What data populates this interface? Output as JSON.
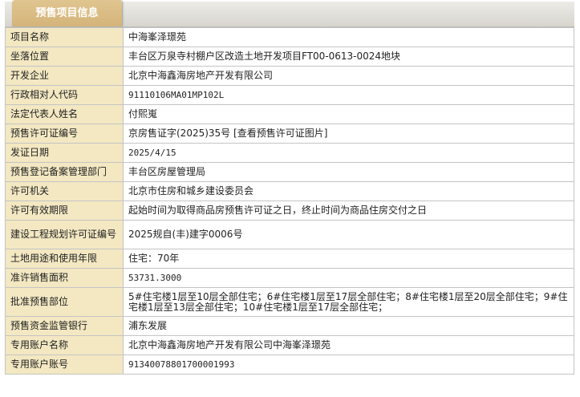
{
  "header": {
    "tab_title": "预售项目信息"
  },
  "rows": [
    {
      "label": "项目名称",
      "value": "中海峯泽璟苑"
    },
    {
      "label": "坐落位置",
      "value": "丰台区万泉寺村棚户区改造土地开发项目FT00-0613-0024地块"
    },
    {
      "label": "开发企业",
      "value": "北京中海鑫海房地产开发有限公司"
    },
    {
      "label": "行政相对人代码",
      "value": "91110106MA01MP102L"
    },
    {
      "label": "法定代表人姓名",
      "value": "付熙嵬"
    },
    {
      "label": "预售许可证编号",
      "value": "京房售证字(2025)35号",
      "link": "[查看预售许可证图片]"
    },
    {
      "label": "发证日期",
      "value": "2025/4/15"
    },
    {
      "label": "预售登记备案管理部门",
      "value": "丰台区房屋管理局"
    },
    {
      "label": "许可机关",
      "value": "北京市住房和城乡建设委员会"
    },
    {
      "label": "许可有效期限",
      "value": "起始时间为取得商品房预售许可证之日，终止时间为商品住房交付之日"
    },
    {
      "label": "建设工程规划许可证编号",
      "value": "2025规自(丰)建字0006号"
    },
    {
      "label": "土地用途和使用年限",
      "value": "住宅：70年"
    },
    {
      "label": "准许销售面积",
      "value": "53731.3000"
    },
    {
      "label": "批准预售部位",
      "value": "5#住宅楼1层至10层全部住宅；6#住宅楼1层至17层全部住宅；8#住宅楼1层至20层全部住宅；9#住宅楼1层至13层全部住宅；10#住宅楼1层至17层全部住宅；"
    },
    {
      "label": "预售资金监管银行",
      "value": "浦东发展"
    },
    {
      "label": "专用账户名称",
      "value": "北京中海鑫海房地产开发有限公司中海峯泽璟苑"
    },
    {
      "label": "专用账户账号",
      "value": "91340078801700001993"
    }
  ]
}
